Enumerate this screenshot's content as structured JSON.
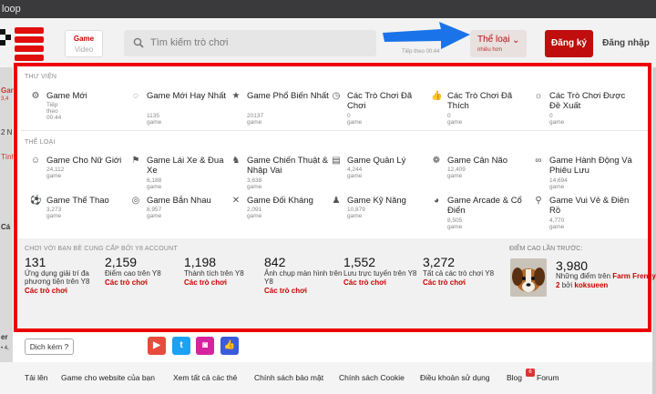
{
  "window": {
    "title": "loop"
  },
  "header": {
    "toggle": {
      "game": "Game",
      "video": "Video"
    },
    "search": {
      "placeholder": "Tìm kiếm trò chơi"
    },
    "next_tiny": "Tiếp theo 00:44",
    "categories_button": {
      "label": "Thể loại",
      "sub": "nhiều hơn"
    },
    "signup": "Đăng ký",
    "login": "Đăng nhập"
  },
  "background": {
    "left_texts": [
      "Gar",
      "2 N",
      "Tình",
      "Cá",
      "Ga",
      "er",
      "• 4,"
    ],
    "left_badge": "3,4"
  },
  "library": {
    "title": "THƯ VIỆN",
    "items": [
      {
        "icon": "gear-icon",
        "name": "Game Mới",
        "count": "Tiếp theo 00:44"
      },
      {
        "icon": "spinner-icon",
        "name": "Game Mới Hay Nhất",
        "count": "1135 game"
      },
      {
        "icon": "star-icon",
        "name": "Game Phổ Biến Nhất",
        "count": "20137 game"
      },
      {
        "icon": "clock-icon",
        "name": "Các Trò Chơi Đã Chơi",
        "count": "0 game"
      },
      {
        "icon": "thumbs-up-icon",
        "name": "Các Trò Chơi Đã Thích",
        "count": "0 game"
      },
      {
        "icon": "sun-icon",
        "name": "Các Trò Chơi Được Đề Xuất",
        "count": "0 game"
      }
    ]
  },
  "genres": {
    "title": "THỂ LOẠI",
    "items": [
      {
        "icon": "girl-icon",
        "name": "Game Cho Nữ Giới",
        "count": "24,112 game"
      },
      {
        "icon": "flag-icon",
        "name": "Game Lái Xe & Đua Xe",
        "count": "6,188 game"
      },
      {
        "icon": "chess-icon",
        "name": "Game Chiến Thuật & Nhập Vai",
        "count": "3,638 game"
      },
      {
        "icon": "cash-icon",
        "name": "Game Quản Lý",
        "count": "4,244 game"
      },
      {
        "icon": "brain-icon",
        "name": "Game Cân Não",
        "count": "12,409 game"
      },
      {
        "icon": "binoculars-icon",
        "name": "Game Hành Động Và Phiêu Lưu",
        "count": "14,694 game"
      },
      {
        "icon": "ball-icon",
        "name": "Game Thể Thao",
        "count": "3,273 game"
      },
      {
        "icon": "target-icon",
        "name": "Game Bắn Nhau",
        "count": "8,957 game"
      },
      {
        "icon": "swords-icon",
        "name": "Game Đối Kháng",
        "count": "2,091 game"
      },
      {
        "icon": "person-icon",
        "name": "Game Kỹ Năng",
        "count": "10,879 game"
      },
      {
        "icon": "pacman-icon",
        "name": "Game Arcade & Cổ Điển",
        "count": "8,505 game"
      },
      {
        "icon": "joystick-icon",
        "name": "Game Vui Vẻ & Điên Rồ",
        "count": "4,770 game"
      }
    ]
  },
  "stats": {
    "title": "CHƠI VỚI BẠN BÈ CUNG CẤP BỞI Y8 ACCOUNT",
    "items": [
      {
        "n": "131",
        "d": "Ứng dụng giải trí đa phương tiện trên Y8",
        "link": "Các trò chơi"
      },
      {
        "n": "2,159",
        "d": "Điểm cao trên Y8",
        "link": "Các trò chơi"
      },
      {
        "n": "1,198",
        "d": "Thành tích trên Y8",
        "link": "Các trò chơi"
      },
      {
        "n": "842",
        "d": "Ảnh chụp màn hình trên Y8",
        "link": "Các trò chơi"
      },
      {
        "n": "1,552",
        "d": "Lưu trực tuyến trên Y8",
        "link": "Các trò chơi"
      },
      {
        "n": "3,272",
        "d": "Tất cả các trò chơi Y8",
        "link": "Các trò chơi"
      }
    ]
  },
  "highscore": {
    "title": "ĐIỂM CAO LẦN TRƯỚC:",
    "score": "3,980",
    "prefix": "Những điểm trên",
    "game": "Farm Frenzy 2",
    "by": "bởi",
    "user": "koksueen"
  },
  "footer": {
    "language": "Dịch kém ?",
    "social": [
      "youtube-icon",
      "twitter-icon",
      "instagram-icon",
      "like-icon"
    ],
    "links": [
      "Tải lên",
      "Game cho website của bạn",
      "Xem tất cả các thẻ",
      "Chính sách bảo mật",
      "Chính sách Cookie",
      "Điều khoản sử dụng",
      "Blog",
      "Forum"
    ],
    "badge": "6"
  },
  "colors": {
    "accent": "#c00d0d",
    "highlight_border": "#ee0000",
    "arrow": "#1a73e8"
  }
}
